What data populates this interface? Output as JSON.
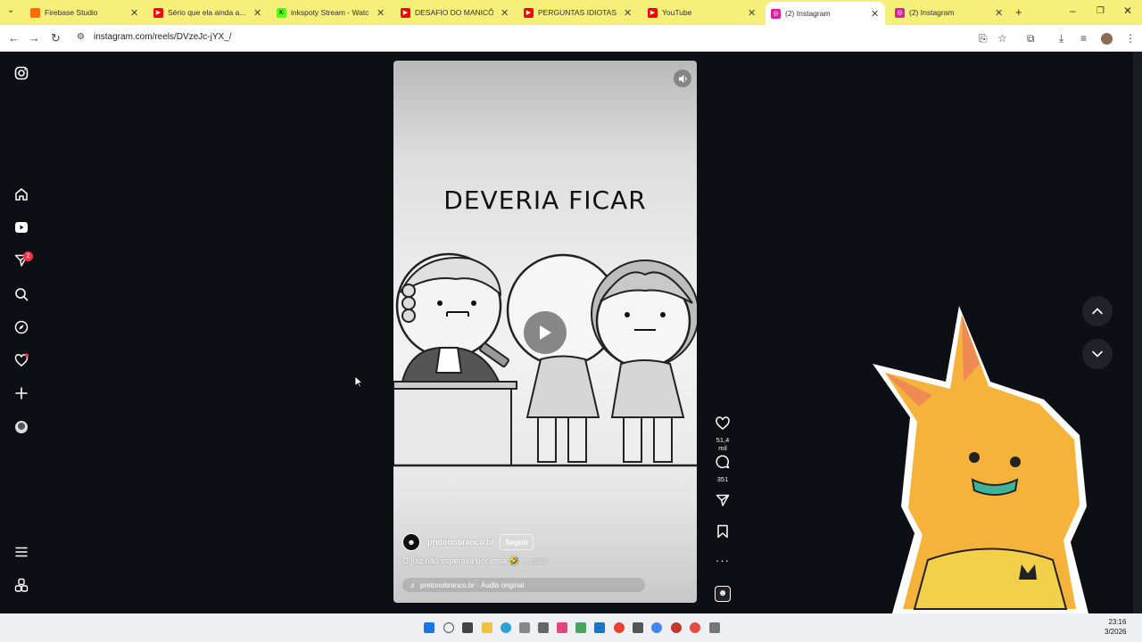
{
  "browser": {
    "tabs": [
      {
        "title": "Firebase Studio",
        "icon": "firebase-icon",
        "color": "#ff6f00"
      },
      {
        "title": "Sério que ela ainda a...",
        "icon": "youtube-icon",
        "color": "#ff0000"
      },
      {
        "title": "inkspoty Stream - Watch",
        "icon": "kick-icon",
        "color": "#53fc18"
      },
      {
        "title": "DESAFIO DO MANICÔMI...",
        "icon": "youtube-icon",
        "color": "#ff0000"
      },
      {
        "title": "PERGUNTAS IDIOTAS - Yo",
        "icon": "youtube-icon",
        "color": "#ff0000"
      },
      {
        "title": "YouTube",
        "icon": "youtube-icon",
        "color": "#ff0000"
      },
      {
        "title": "(2) Instagram",
        "icon": "instagram-icon",
        "color": "#d6249f"
      },
      {
        "title": "(2) Instagram",
        "icon": "instagram-icon",
        "color": "#d6249f"
      }
    ],
    "active_tab_index": 6,
    "url": "instagram.com/reels/DVzeJc-jYX_/"
  },
  "reel": {
    "title_text": "DEVERIA FICAR",
    "username": "pretonobranco.br",
    "follow_label": "Seguir",
    "caption": "O juiz não esperava por essa 🤣",
    "more_label": "... mais",
    "audio": "pretonobranco.br · Áudio original",
    "likes": "51,4 mil",
    "comments": "351"
  },
  "sidebar": {
    "notification_count": "2"
  },
  "taskbar": {
    "time": "23:16",
    "date": "3/2026"
  }
}
